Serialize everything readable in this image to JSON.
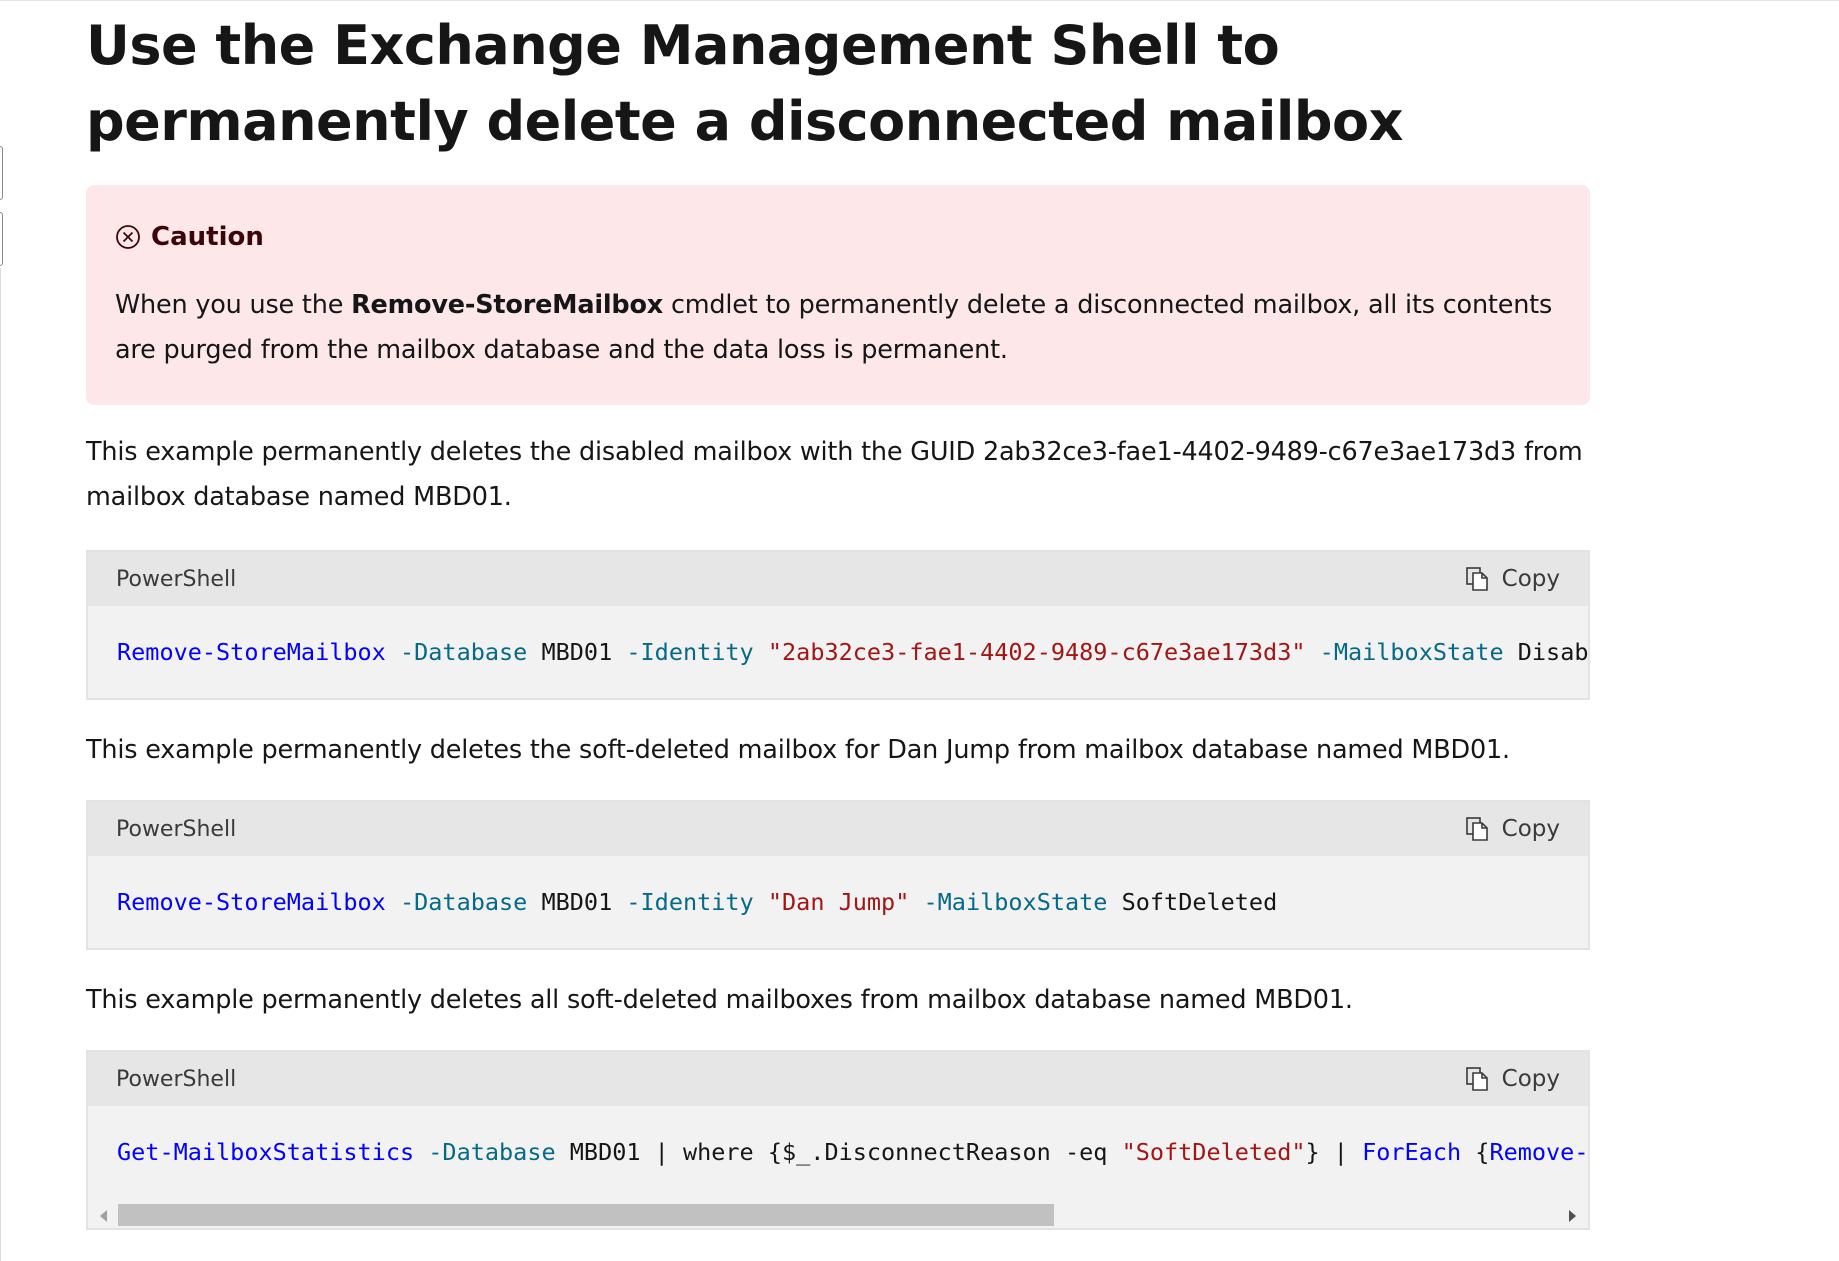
{
  "heading": "Use the Exchange Management Shell to permanently delete a disconnected mailbox",
  "caution": {
    "title": "Caution",
    "text_before": "When you use the ",
    "bold": "Remove-StoreMailbox",
    "text_after": " cmdlet to permanently delete a disconnected mailbox, all its contents are purged from the mailbox database and the data loss is permanent."
  },
  "examples": [
    {
      "description": "This example permanently deletes the disabled mailbox with the GUID 2ab32ce3-fae1-4402-9489-c67e3ae173d3 from mailbox database named MBD01.",
      "language": "PowerShell",
      "copy_label": "Copy",
      "code": [
        {
          "t": "cmd",
          "v": "Remove-StoreMailbox"
        },
        {
          "t": "plain",
          "v": " "
        },
        {
          "t": "param",
          "v": "-Database"
        },
        {
          "t": "plain",
          "v": " MBD01 "
        },
        {
          "t": "param",
          "v": "-Identity"
        },
        {
          "t": "plain",
          "v": " "
        },
        {
          "t": "str",
          "v": "\"2ab32ce3-fae1-4402-9489-c67e3ae173d3\""
        },
        {
          "t": "plain",
          "v": " "
        },
        {
          "t": "param",
          "v": "-MailboxState"
        },
        {
          "t": "plain",
          "v": " Disabled"
        }
      ]
    },
    {
      "description": "This example permanently deletes the soft-deleted mailbox for Dan Jump from mailbox database named MBD01.",
      "language": "PowerShell",
      "copy_label": "Copy",
      "code": [
        {
          "t": "cmd",
          "v": "Remove-StoreMailbox"
        },
        {
          "t": "plain",
          "v": " "
        },
        {
          "t": "param",
          "v": "-Database"
        },
        {
          "t": "plain",
          "v": " MBD01 "
        },
        {
          "t": "param",
          "v": "-Identity"
        },
        {
          "t": "plain",
          "v": " "
        },
        {
          "t": "str",
          "v": "\"Dan Jump\""
        },
        {
          "t": "plain",
          "v": " "
        },
        {
          "t": "param",
          "v": "-MailboxState"
        },
        {
          "t": "plain",
          "v": " SoftDeleted"
        }
      ]
    },
    {
      "description": "This example permanently deletes all soft-deleted mailboxes from mailbox database named MBD01.",
      "language": "PowerShell",
      "copy_label": "Copy",
      "code": [
        {
          "t": "cmd",
          "v": "Get-MailboxStatistics"
        },
        {
          "t": "plain",
          "v": " "
        },
        {
          "t": "param",
          "v": "-Database"
        },
        {
          "t": "plain",
          "v": " MBD01 | where {$_.DisconnectReason -eq "
        },
        {
          "t": "str",
          "v": "\"SoftDeleted\""
        },
        {
          "t": "plain",
          "v": "} | "
        },
        {
          "t": "cmd",
          "v": "ForEach"
        },
        {
          "t": "plain",
          "v": " {"
        },
        {
          "t": "cmd",
          "v": "Remove-StoreMailbox"
        }
      ],
      "scroll_position": 0.65
    }
  ],
  "icons": {
    "caution": "circle-x-icon",
    "copy": "copy-icon"
  }
}
